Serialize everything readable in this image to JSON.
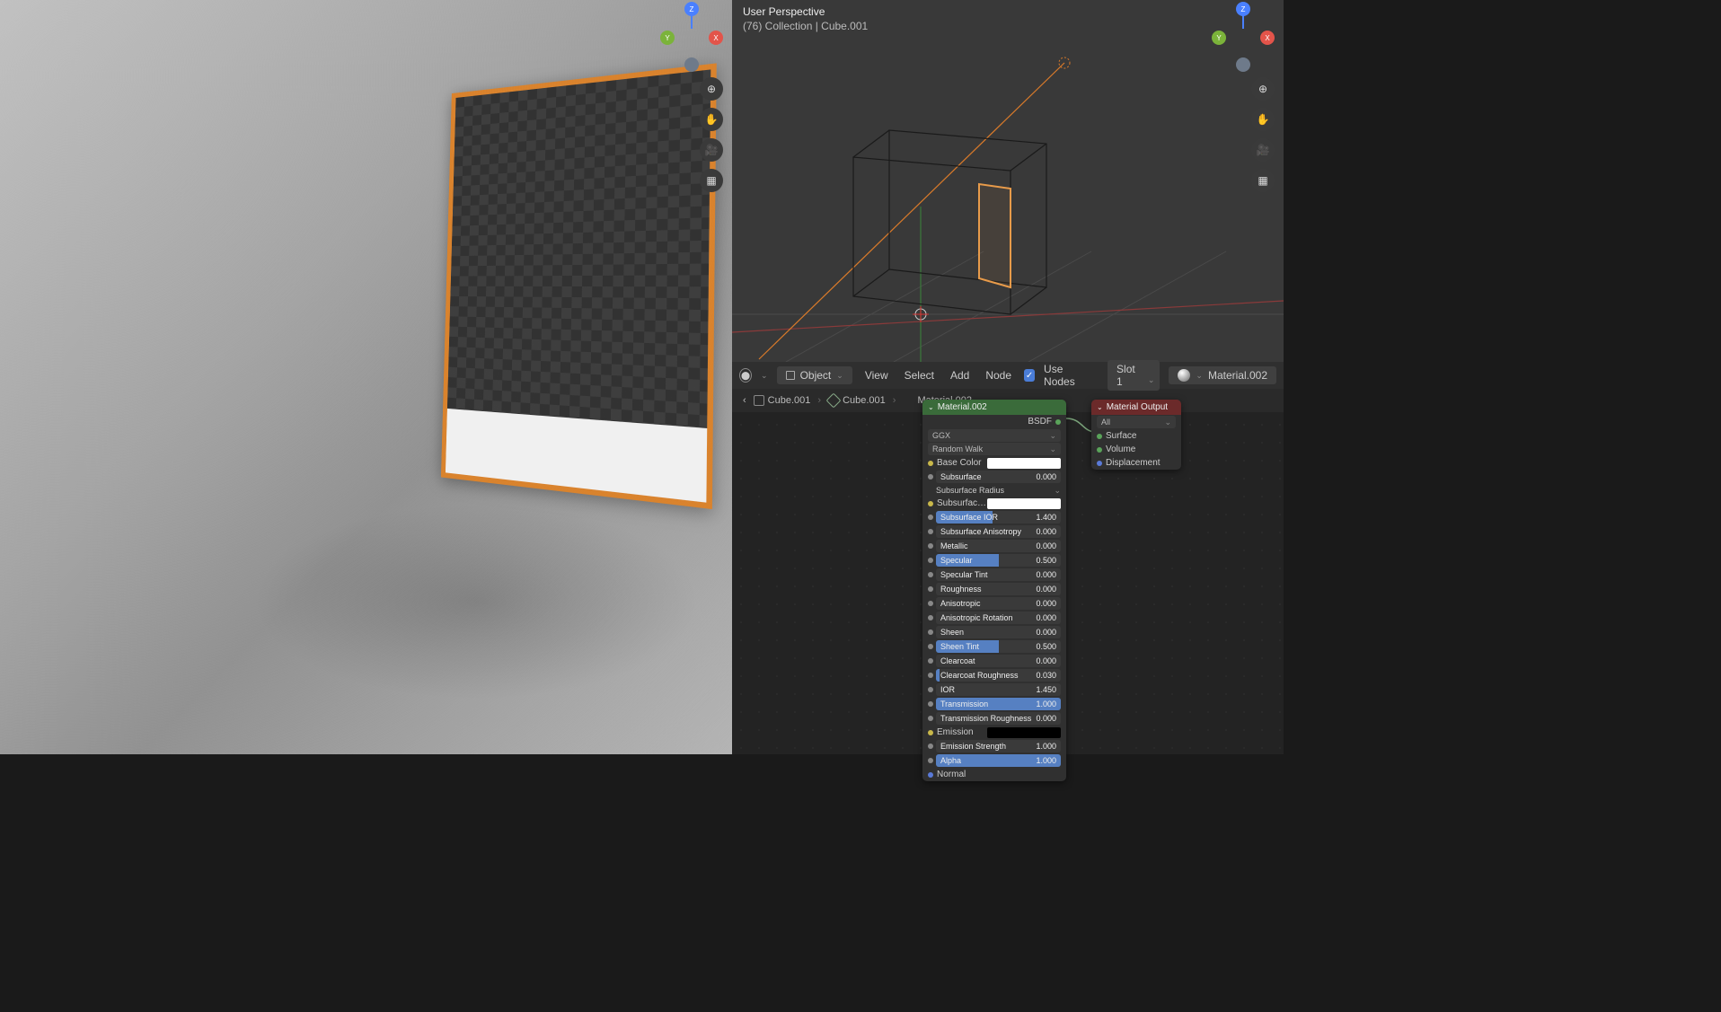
{
  "right_viewport": {
    "perspective_label": "User Perspective",
    "info_line": "(76) Collection | Cube.001"
  },
  "gizmo": {
    "x": "X",
    "y": "Y",
    "z": "Z"
  },
  "viewport_buttons": {
    "zoom": "⊕",
    "pan": "✋",
    "camera": "🎥",
    "ortho": "▦"
  },
  "node_editor": {
    "header": {
      "mode": "Object",
      "menus": [
        "View",
        "Select",
        "Add",
        "Node"
      ],
      "use_nodes_label": "Use Nodes",
      "slot": "Slot 1",
      "material": "Material.002"
    },
    "breadcrumb": {
      "obj": "Cube.001",
      "mesh": "Cube.001",
      "material": "Material.002"
    },
    "bsdf_node": {
      "title": "Material.002",
      "output_label": "BSDF",
      "distribution": "GGX",
      "subsurface_method": "Random Walk",
      "params": [
        {
          "name": "Base Color",
          "type": "color",
          "value": "#ffffff",
          "sock": "yellow"
        },
        {
          "name": "Subsurface",
          "type": "slider",
          "value": "0.000",
          "fill": 0,
          "sock": "grey"
        },
        {
          "name": "Subsurface Radius",
          "type": "drop",
          "sock": "blue"
        },
        {
          "name": "Subsurface Colo",
          "type": "color",
          "value": "#ffffff",
          "sock": "yellow"
        },
        {
          "name": "Subsurface IOR",
          "type": "slider",
          "value": "1.400",
          "fill": 45,
          "sock": "grey"
        },
        {
          "name": "Subsurface Anisotropy",
          "type": "slider",
          "value": "0.000",
          "fill": 0,
          "sock": "grey"
        },
        {
          "name": "Metallic",
          "type": "slider",
          "value": "0.000",
          "fill": 0,
          "sock": "grey"
        },
        {
          "name": "Specular",
          "type": "slider",
          "value": "0.500",
          "fill": 50,
          "sock": "grey"
        },
        {
          "name": "Specular Tint",
          "type": "slider",
          "value": "0.000",
          "fill": 0,
          "sock": "grey"
        },
        {
          "name": "Roughness",
          "type": "slider",
          "value": "0.000",
          "fill": 0,
          "sock": "grey"
        },
        {
          "name": "Anisotropic",
          "type": "slider",
          "value": "0.000",
          "fill": 0,
          "sock": "grey"
        },
        {
          "name": "Anisotropic Rotation",
          "type": "slider",
          "value": "0.000",
          "fill": 0,
          "sock": "grey"
        },
        {
          "name": "Sheen",
          "type": "slider",
          "value": "0.000",
          "fill": 0,
          "sock": "grey"
        },
        {
          "name": "Sheen Tint",
          "type": "slider",
          "value": "0.500",
          "fill": 50,
          "sock": "grey"
        },
        {
          "name": "Clearcoat",
          "type": "slider",
          "value": "0.000",
          "fill": 0,
          "sock": "grey"
        },
        {
          "name": "Clearcoat Roughness",
          "type": "slider",
          "value": "0.030",
          "fill": 3,
          "sock": "grey"
        },
        {
          "name": "IOR",
          "type": "slider",
          "value": "1.450",
          "fill": 0,
          "sock": "grey"
        },
        {
          "name": "Transmission",
          "type": "slider",
          "value": "1.000",
          "fill": 100,
          "sock": "grey"
        },
        {
          "name": "Transmission Roughness",
          "type": "slider",
          "value": "0.000",
          "fill": 0,
          "sock": "grey"
        },
        {
          "name": "Emission",
          "type": "color",
          "value": "#000000",
          "sock": "yellow"
        },
        {
          "name": "Emission Strength",
          "type": "slider",
          "value": "1.000",
          "fill": 0,
          "sock": "grey"
        },
        {
          "name": "Alpha",
          "type": "slider",
          "value": "1.000",
          "fill": 100,
          "sock": "grey"
        },
        {
          "name": "Normal",
          "type": "input",
          "sock": "blue"
        }
      ]
    },
    "output_node": {
      "title": "Material Output",
      "target": "All",
      "inputs": [
        "Surface",
        "Volume",
        "Displacement"
      ]
    }
  }
}
